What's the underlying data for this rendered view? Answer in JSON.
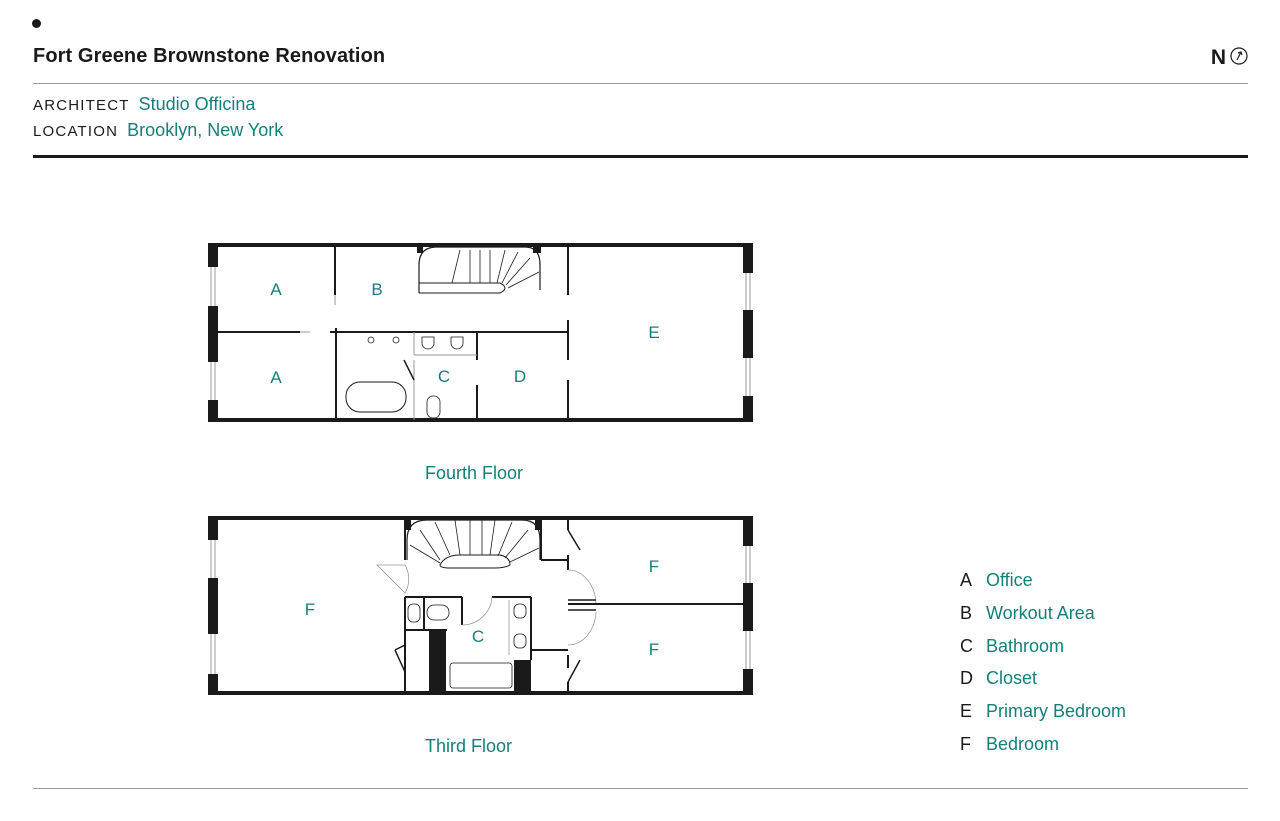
{
  "header": {
    "title": "Fort Greene Brownstone Renovation",
    "north_label": "N",
    "north_icon": "north-arrow-icon"
  },
  "meta": {
    "architect_label": "ARCHITECT",
    "architect_value": "Studio Officina",
    "location_label": "LOCATION",
    "location_value": "Brooklyn, New York"
  },
  "colors": {
    "accent": "#137f79",
    "ink": "#1a1a1a",
    "rule": "#9a9a9a"
  },
  "plans": {
    "fourth_floor": {
      "label": "Fourth Floor",
      "rooms": [
        "A",
        "B",
        "A",
        "C",
        "D",
        "E"
      ]
    },
    "third_floor": {
      "label": "Third Floor",
      "rooms": [
        "F",
        "C",
        "F",
        "F"
      ]
    }
  },
  "legend": [
    {
      "letter": "A",
      "name": "Office"
    },
    {
      "letter": "B",
      "name": "Workout Area"
    },
    {
      "letter": "C",
      "name": "Bathroom"
    },
    {
      "letter": "D",
      "name": "Closet"
    },
    {
      "letter": "E",
      "name": "Primary Bedroom"
    },
    {
      "letter": "F",
      "name": "Bedroom"
    }
  ]
}
